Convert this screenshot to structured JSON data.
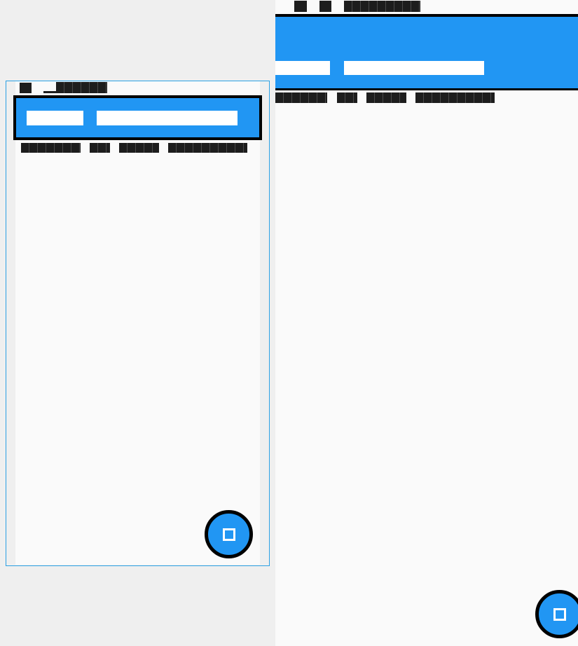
{
  "colors": {
    "page_background": "#efefef",
    "app_background": "#fafafa",
    "app_bar": "#2196f3",
    "selection_outline": "#000000",
    "frame_outline": "#2aa0e4",
    "placeholder_text": "#1d1d1d",
    "tab_placeholder": "#ffffff"
  },
  "icons": {
    "fab": "square-icon"
  },
  "left_panel": {
    "status_bar_items": [
      "placeholder-block",
      "placeholder-block"
    ],
    "app_bar_tabs": [
      "placeholder-tab",
      "placeholder-tab"
    ],
    "subheader_items": [
      "placeholder-block",
      "placeholder-block",
      "placeholder-block",
      "placeholder-block"
    ]
  },
  "right_panel": {
    "status_bar_items": [
      "placeholder-block",
      "placeholder-block"
    ],
    "app_bar_tabs": [
      "placeholder-tab",
      "placeholder-tab"
    ],
    "subheader_items": [
      "placeholder-block",
      "placeholder-block",
      "placeholder-block",
      "placeholder-block"
    ]
  }
}
